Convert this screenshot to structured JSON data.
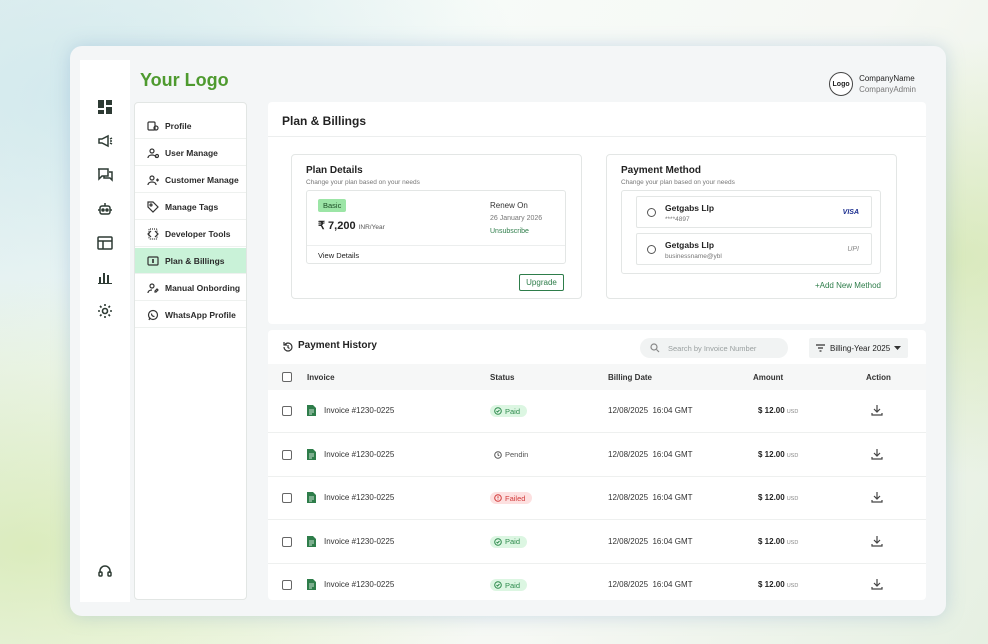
{
  "brand": {
    "logo_text": "Your Logo"
  },
  "company": {
    "logo_label": "Logo",
    "name": "CompanyName",
    "role": "CompanyAdmin"
  },
  "rail": {
    "icons": [
      "dashboard-icon",
      "megaphone-icon",
      "chat-icon",
      "bot-icon",
      "browser-icon",
      "bar-chart-icon",
      "gear-icon",
      "help-headset-icon"
    ],
    "active": "gear-icon"
  },
  "settings_menu": {
    "items": [
      {
        "label": "Profile",
        "icon": "profile-settings-icon"
      },
      {
        "label": "User Manage",
        "icon": "user-manage-icon"
      },
      {
        "label": "Customer Manage",
        "icon": "customer-manage-icon"
      },
      {
        "label": "Manage Tags",
        "icon": "tag-icon"
      },
      {
        "label": "Developer Tools",
        "icon": "developer-tools-icon"
      },
      {
        "label": "Plan & Billings",
        "icon": "billing-icon"
      },
      {
        "label": "Manual Onbording",
        "icon": "onboarding-icon"
      },
      {
        "label": "WhatsApp Profile",
        "icon": "whatsapp-icon"
      }
    ],
    "active_index": 5
  },
  "page": {
    "title": "Plan & Billings"
  },
  "plan_details": {
    "title": "Plan Details",
    "subtitle": "Change your plan based on your needs",
    "plan_name": "Basic",
    "price": "₹ 7,200",
    "price_unit": "INR/Year",
    "renew_label": "Renew On",
    "renew_date": "26 January 2026",
    "unsubscribe": "Unsubscribe",
    "view_details": "View Details",
    "upgrade": "Upgrade"
  },
  "payment_method": {
    "title": "Payment Method",
    "subtitle": "Change your plan based on your needs",
    "methods": [
      {
        "name": "Getgabs Llp",
        "detail": "****4897",
        "brand": "VISA"
      },
      {
        "name": "Getgabs Llp",
        "detail": "businessname@ybl",
        "brand": "UPI"
      }
    ],
    "add_new": "+Add New Method"
  },
  "payment_history": {
    "title": "Payment History",
    "search_placeholder": "Search by Invoice Number",
    "filter_label": "Billing-Year 2025",
    "columns": [
      "Invoice",
      "Status",
      "Billing Date",
      "Amount",
      "Action"
    ],
    "rows": [
      {
        "invoice": "Invoice #1230-0225",
        "status": "Paid",
        "status_type": "paid",
        "date": "12/08/2025  16:04 GMT",
        "amount": "$ 12.00",
        "currency": "USD"
      },
      {
        "invoice": "Invoice #1230-0225",
        "status": "Pendin",
        "status_type": "pending",
        "date": "12/08/2025  16:04 GMT",
        "amount": "$ 12.00",
        "currency": "USD"
      },
      {
        "invoice": "Invoice #1230-0225",
        "status": "Failed",
        "status_type": "failed",
        "date": "12/08/2025  16:04 GMT",
        "amount": "$ 12.00",
        "currency": "USD"
      },
      {
        "invoice": "Invoice #1230-0225",
        "status": "Paid",
        "status_type": "paid",
        "date": "12/08/2025  16:04 GMT",
        "amount": "$ 12.00",
        "currency": "USD"
      },
      {
        "invoice": "Invoice #1230-0225",
        "status": "Paid",
        "status_type": "paid",
        "date": "12/08/2025  16:04 GMT",
        "amount": "$ 12.00",
        "currency": "USD"
      }
    ]
  },
  "colors": {
    "accent": "#2e7d4a",
    "logo": "#4e9a2f",
    "active_menu": "#c9f2d8",
    "paid": "#2e8b4d",
    "failed": "#d23c3c"
  }
}
